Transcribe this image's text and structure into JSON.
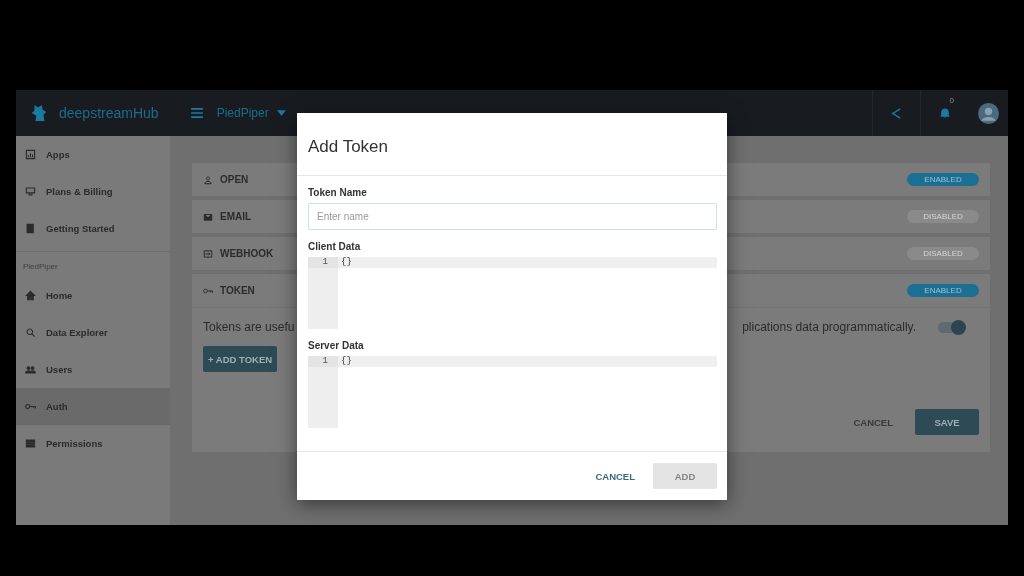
{
  "header": {
    "brand": "deepstreamHub",
    "project": "PiedPiper",
    "notification_count": "0"
  },
  "sidebar": {
    "items": [
      {
        "label": "Apps",
        "selected": false
      },
      {
        "label": "Plans & Billing",
        "selected": false
      },
      {
        "label": "Getting Started",
        "selected": false
      }
    ],
    "section_label": "PiedPiper",
    "project_items": [
      {
        "label": "Home",
        "selected": false
      },
      {
        "label": "Data Explorer",
        "selected": false
      },
      {
        "label": "Users",
        "selected": false
      },
      {
        "label": "Auth",
        "selected": true
      },
      {
        "label": "Permissions",
        "selected": false
      }
    ]
  },
  "auth_methods": [
    {
      "label": "OPEN",
      "status": "ENABLED",
      "enabled": true,
      "expanded": false
    },
    {
      "label": "EMAIL",
      "status": "DISABLED",
      "enabled": false,
      "expanded": false
    },
    {
      "label": "WEBHOOK",
      "status": "DISABLED",
      "enabled": false,
      "expanded": false
    },
    {
      "label": "TOKEN",
      "status": "ENABLED",
      "enabled": true,
      "expanded": true
    }
  ],
  "token_panel": {
    "description_start": "Tokens are usefu",
    "description_end": "plications data programmatically.",
    "toggle": {
      "on": true
    },
    "add_button": "+ ADD TOKEN",
    "cancel_button": "CANCEL",
    "save_button": "SAVE"
  },
  "dialog": {
    "title": "Add Token",
    "name_field": {
      "label": "Token Name",
      "placeholder": "Enter name"
    },
    "editors": [
      {
        "label": "Client Data",
        "lines": [
          {
            "number": "1",
            "code": "{}"
          }
        ]
      },
      {
        "label": "Server Data",
        "lines": [
          {
            "number": "1",
            "code": "{}"
          }
        ]
      }
    ],
    "cancel_button": "CANCEL",
    "add_button": {
      "label": "ADD",
      "disabled": true
    }
  }
}
